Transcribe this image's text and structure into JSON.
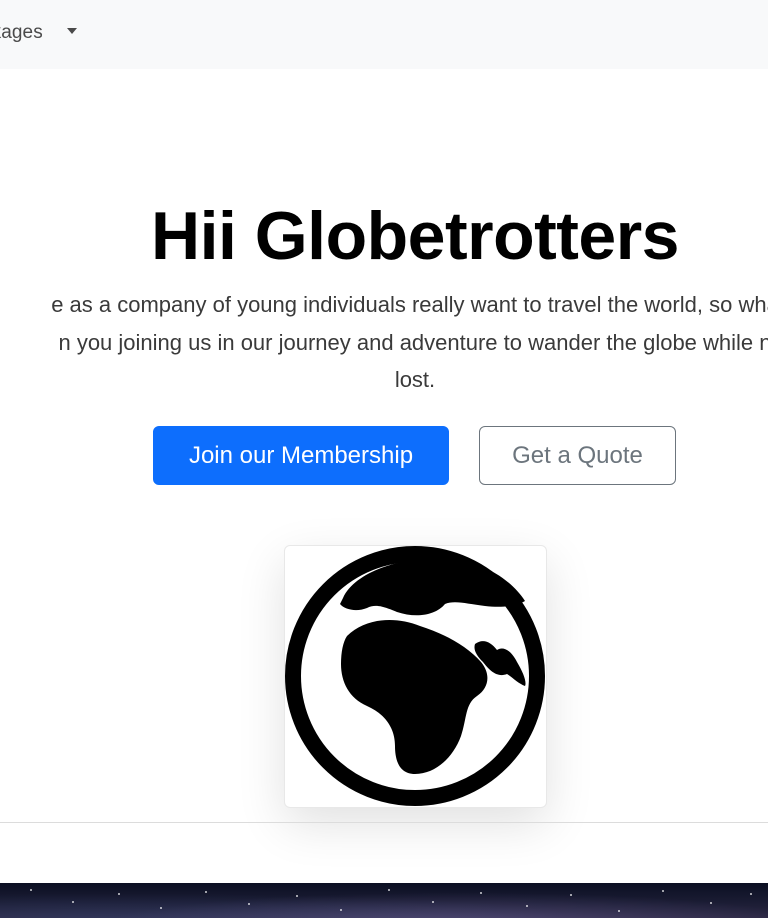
{
  "navbar": {
    "dropdown_label": "ckages"
  },
  "hero": {
    "title": "Hii Globetrotters",
    "description_lines": [
      "e as a company of young individuals really want to travel the world, so wha",
      "n you joining us in our journey and adventure to wander the globe while n",
      "lost."
    ],
    "primary_button": "Join our Membership",
    "secondary_button": "Get a Quote"
  },
  "globe_card": {
    "icon": "globe-icon"
  },
  "colors": {
    "navbar_bg": "#f8f9fa",
    "primary": "#0d6efd",
    "secondary": "#6c757d",
    "text_dark": "#000000"
  }
}
